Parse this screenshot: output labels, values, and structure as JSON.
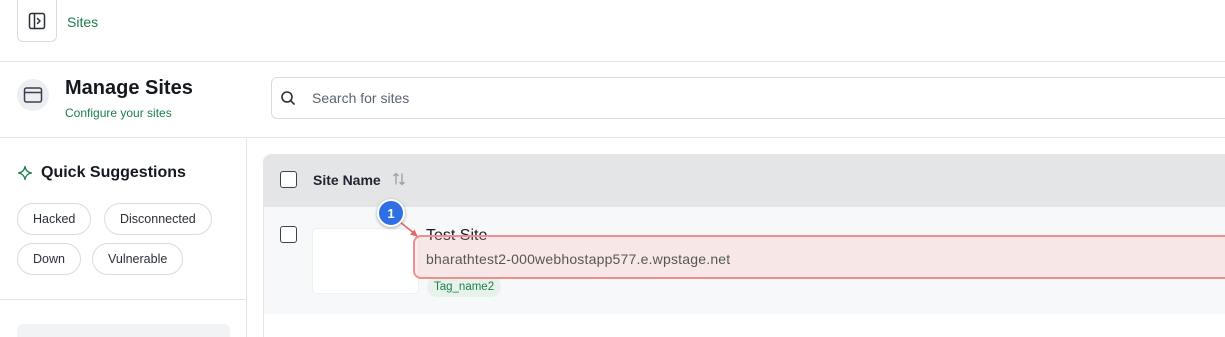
{
  "topbar": {
    "toggle_icon": "sidebar-toggle-icon",
    "breadcrumb": "Sites"
  },
  "header": {
    "icon": "browser-window-icon",
    "title": "Manage Sites",
    "subtitle": "Configure your sites"
  },
  "search": {
    "icon": "search-icon",
    "placeholder": "Search for sites",
    "value": ""
  },
  "sidebar": {
    "title": "Quick Suggestions",
    "title_icon": "sparkle-icon",
    "chips": [
      "Hacked",
      "Disconnected",
      "Down",
      "Vulnerable"
    ]
  },
  "table": {
    "columns": [
      {
        "label": "Site Name",
        "sort_icon": "sort-arrows-icon"
      }
    ],
    "rows": [
      {
        "name": "Test Site",
        "url": "bharathtest2-000webhostapp577.e.wpstage.net",
        "tags": [
          "Tag_name2"
        ]
      }
    ]
  },
  "annotation": {
    "number": "1",
    "highlight_color": "#f08f8f",
    "badge_color": "#2f6fe4"
  },
  "colors": {
    "accent": "#1a7f4b",
    "border": "#d8dbe0",
    "header_bg": "#e4e5e7"
  }
}
